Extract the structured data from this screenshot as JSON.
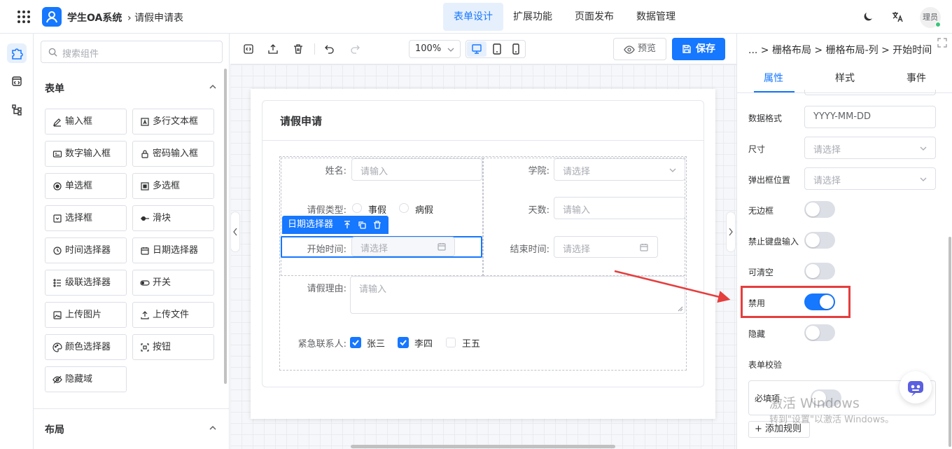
{
  "header": {
    "app_title": "学生OA系统",
    "breadcrumb": "请假申请表",
    "tabs": [
      {
        "label": "表单设计",
        "active": true
      },
      {
        "label": "扩展功能"
      },
      {
        "label": "页面发布"
      },
      {
        "label": "数据管理"
      }
    ],
    "avatar_text": "理员"
  },
  "panel": {
    "search_placeholder": "搜索组件",
    "form_section": "表单",
    "layout_section": "布局",
    "components": [
      {
        "label": "输入框",
        "icon": "edit-icon"
      },
      {
        "label": "多行文本框",
        "icon": "textarea-icon"
      },
      {
        "label": "数字输入框",
        "icon": "number-icon"
      },
      {
        "label": "密码输入框",
        "icon": "lock-icon"
      },
      {
        "label": "单选框",
        "icon": "radio-icon"
      },
      {
        "label": "多选框",
        "icon": "checkbox-icon"
      },
      {
        "label": "选择框",
        "icon": "select-icon"
      },
      {
        "label": "滑块",
        "icon": "slider-icon"
      },
      {
        "label": "时间选择器",
        "icon": "clock-icon"
      },
      {
        "label": "日期选择器",
        "icon": "calendar-icon"
      },
      {
        "label": "级联选择器",
        "icon": "cascader-icon"
      },
      {
        "label": "开关",
        "icon": "switch-icon"
      },
      {
        "label": "上传图片",
        "icon": "image-icon"
      },
      {
        "label": "上传文件",
        "icon": "upload-icon"
      },
      {
        "label": "颜色选择器",
        "icon": "palette-icon"
      },
      {
        "label": "按钮",
        "icon": "button-icon"
      },
      {
        "label": "隐藏域",
        "icon": "eye-off-icon"
      }
    ]
  },
  "toolbar": {
    "zoom": "100%",
    "preview_label": "预览",
    "save_label": "保存"
  },
  "form": {
    "title": "请假申请",
    "name_label": "姓名:",
    "name_ph": "请输入",
    "college_label": "学院:",
    "college_ph": "请选择",
    "type_label": "请假类型:",
    "type_options": [
      "事假",
      "病假"
    ],
    "days_label": "天数:",
    "days_ph": "请输入",
    "selected_tag": "日期选择器",
    "start_label": "开始时间:",
    "start_ph": "请选择",
    "end_label": "结束时间:",
    "end_ph": "请选择",
    "reason_label": "请假理由:",
    "reason_ph": "请输入",
    "contact_label": "紧急联系人:",
    "contacts": [
      {
        "label": "张三",
        "checked": true
      },
      {
        "label": "李四",
        "checked": true
      },
      {
        "label": "王五",
        "checked": false
      }
    ]
  },
  "right": {
    "breadcrumb": "... > 栅格布局 > 栅格布局-列 > 开始时间",
    "tabs": [
      "属性",
      "样式",
      "事件"
    ],
    "active_tab": "属性",
    "format_label": "数据格式",
    "format_value": "YYYY-MM-DD",
    "size_label": "尺寸",
    "size_ph": "请选择",
    "popup_label": "弹出框位置",
    "popup_ph": "请选择",
    "switches": [
      {
        "label": "无边框",
        "on": false
      },
      {
        "label": "禁止键盘输入",
        "on": false
      },
      {
        "label": "可清空",
        "on": false
      },
      {
        "label": "禁用",
        "on": true
      },
      {
        "label": "隐藏",
        "on": false
      }
    ],
    "validation_label": "表单校验",
    "required_label": "必填项",
    "add_rule_label": "添加规则",
    "watermark_1": "激活 Windows",
    "watermark_2": "转到\"设置\"以激活 Windows。"
  },
  "colors": {
    "primary": "#1677ff",
    "highlight": "#e53e3e",
    "border": "#dcdfe6"
  }
}
